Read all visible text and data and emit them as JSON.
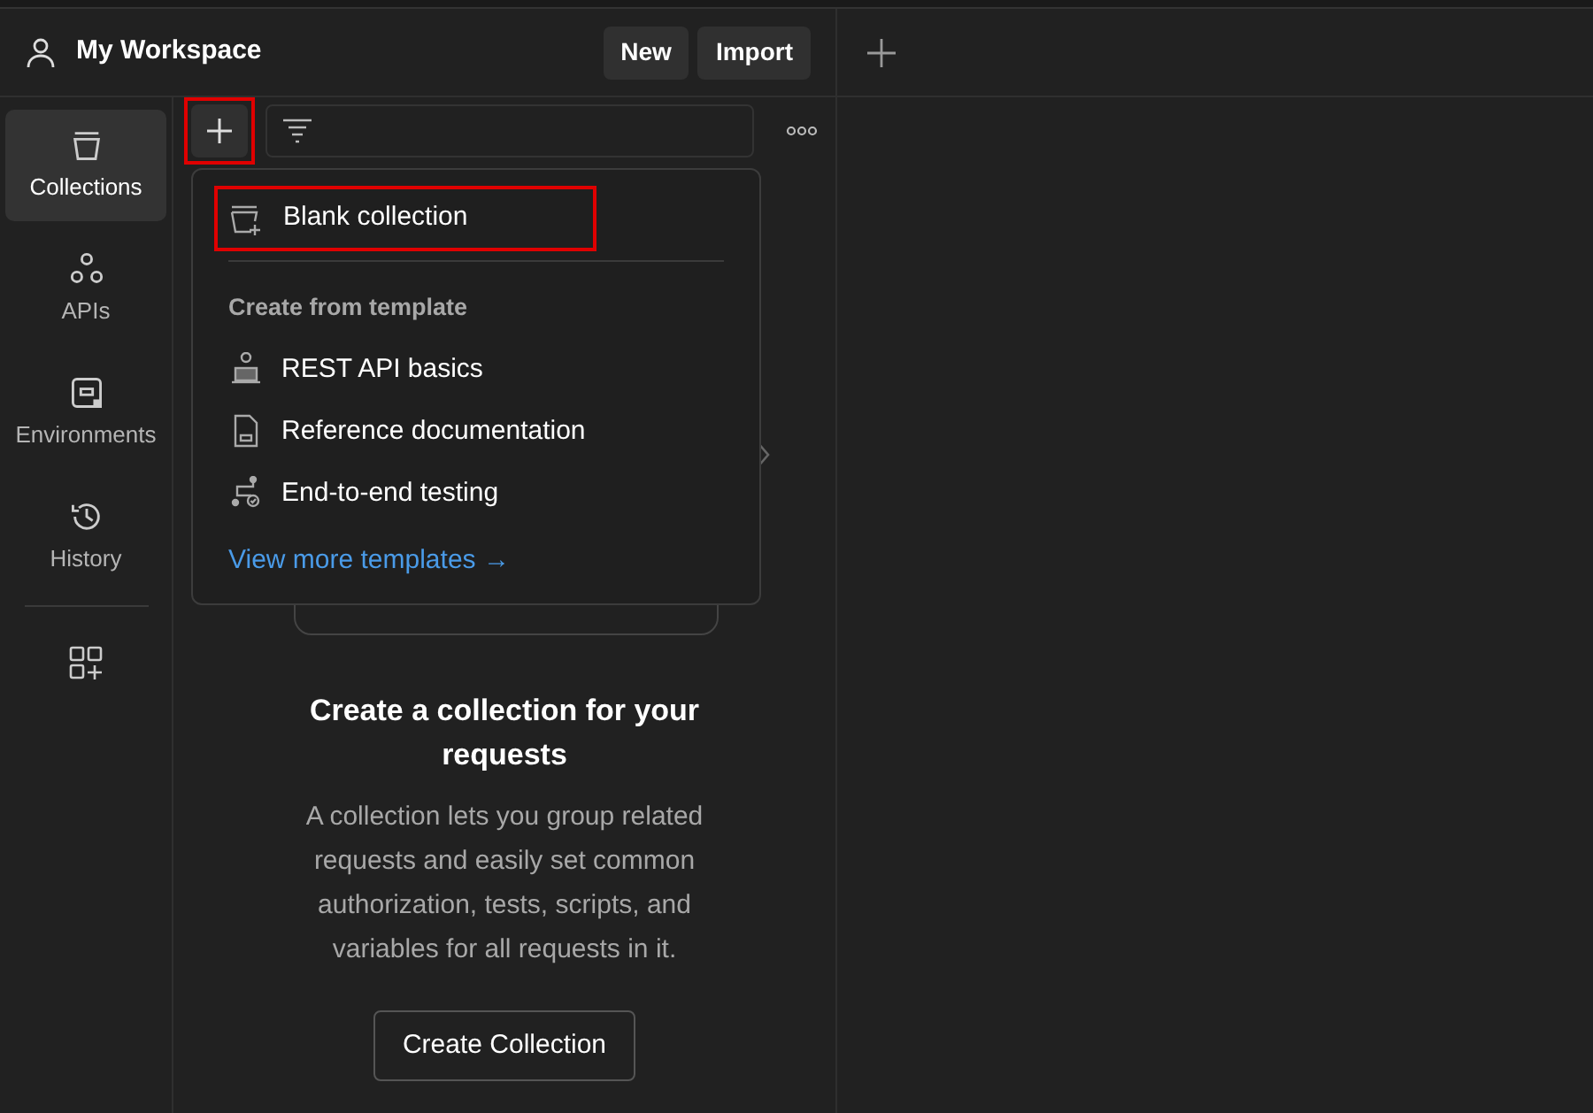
{
  "header": {
    "workspace": "My Workspace",
    "buttons": [
      "New",
      "Import"
    ]
  },
  "rail": {
    "items": [
      {
        "label": "Collections",
        "kind": "collections",
        "selected": true
      },
      {
        "label": "APIs",
        "kind": "apis",
        "selected": false
      },
      {
        "label": "Environments",
        "kind": "environments",
        "selected": false
      },
      {
        "label": "History",
        "kind": "history",
        "selected": false
      }
    ]
  },
  "toolbar": {
    "add_highlighted": true
  },
  "menu": {
    "blank": {
      "label": "Blank collection",
      "highlighted": true
    },
    "section": "Create from template",
    "templates": [
      {
        "label": "REST API basics",
        "kind": "rest"
      },
      {
        "label": "Reference documentation",
        "kind": "docs"
      },
      {
        "label": "End-to-end testing",
        "kind": "e2e"
      }
    ],
    "link": "View more templates →"
  },
  "empty_state": {
    "title": "Create a collection for your requests",
    "description": "A collection lets you group related requests and easily set common authorization, tests, scripts, and variables for all requests in it.",
    "button": "Create Collection"
  }
}
